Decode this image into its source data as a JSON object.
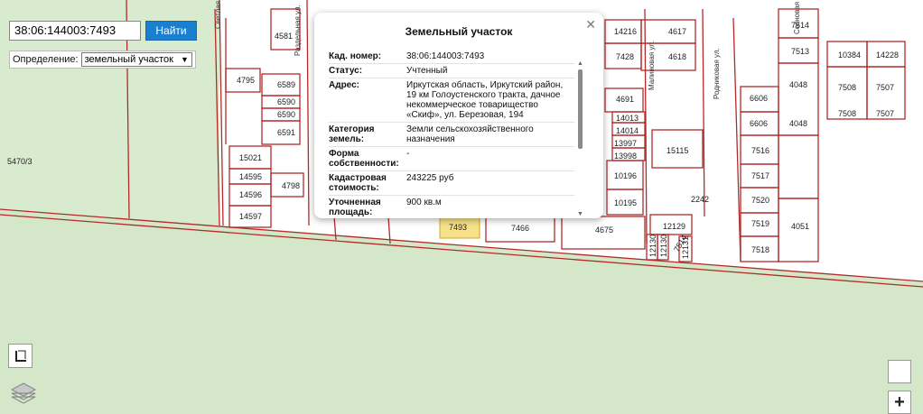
{
  "search": {
    "value": "38:06:144003:7493",
    "button": "Найти"
  },
  "definition": {
    "label": "Определение:",
    "selected": "земельный участок"
  },
  "popup": {
    "title": "Земельный участок",
    "rows": [
      {
        "key": "Кад. номер:",
        "value": "38:06:144003:7493"
      },
      {
        "key": "Статус:",
        "value": "Учтенный"
      },
      {
        "key": "Адрес:",
        "value": "Иркутская область, Иркутский район, 19 км Голоустенского тракта, дачное некоммерческое товарищество «Скиф», ул. Березовая, 194"
      },
      {
        "key": "Категория земель:",
        "value": "Земли сельскохозяйственного назначения"
      },
      {
        "key": "Форма собственности:",
        "value": "-"
      },
      {
        "key": "Кадастровая стоимость:",
        "value": "243225 руб"
      },
      {
        "key": "Уточненная площадь:",
        "value": "900 кв.м"
      }
    ]
  },
  "parcels": [
    "4581",
    "4795",
    "6589",
    "6590",
    "6590",
    "6591",
    "15021",
    "14595",
    "4798",
    "14596",
    "14597",
    "5470/3",
    "7493",
    "7466",
    "4675",
    "14216",
    "4617",
    "7428",
    "4618",
    "4691",
    "14013",
    "14014",
    "13997",
    "13998",
    "15115",
    "10196",
    "10195",
    "2242",
    "12129",
    "12130",
    "12130",
    "12131",
    "7514",
    "7513",
    "10384",
    "14228",
    "4048",
    "7508",
    "7507",
    "7508",
    "7507",
    "6606",
    "6606",
    "4048",
    "7516",
    "7517",
    "7520",
    "7519",
    "4051",
    "7518"
  ],
  "streets": [
    "Раздельная ул.",
    "Родниковая ул.",
    "Сосновая ул.",
    "Малиновая ул.",
    "Светлая ул."
  ],
  "colors": {
    "grass": "#d4e8c9",
    "parcel_line": "#b22a2a",
    "highlight": "#f7e289",
    "button": "#1b7fd0"
  },
  "icons": {
    "close": "close-icon",
    "frame": "frame-icon",
    "layers": "layers-icon",
    "zoom_in": "zoom-in-icon"
  },
  "controls": {
    "zoom_in": "+"
  }
}
